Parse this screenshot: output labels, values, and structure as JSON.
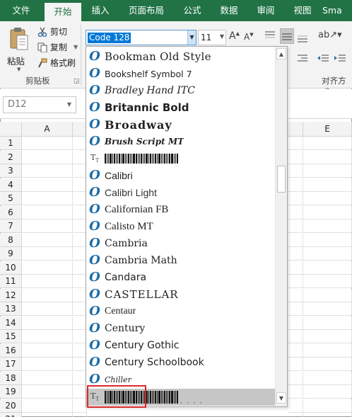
{
  "tabs": [
    "文件",
    "开始",
    "插入",
    "页面布局",
    "公式",
    "数据",
    "审阅",
    "视图",
    "Sma"
  ],
  "active_tab": "开始",
  "clipboard": {
    "paste_label": "粘贴",
    "cut_label": "剪切",
    "copy_label": "复制",
    "format_painter_label": "格式刷",
    "group_label": "剪贴板"
  },
  "font": {
    "name_value": "Code 128",
    "size_value": "11"
  },
  "alignment": {
    "group_label": "对齐方式"
  },
  "name_box": {
    "value": "D12"
  },
  "columns": [
    "A",
    "E"
  ],
  "rows": [
    "1",
    "2",
    "3",
    "4",
    "5",
    "6",
    "7",
    "8",
    "9",
    "10",
    "11",
    "12",
    "13",
    "14",
    "15",
    "16",
    "17",
    "18",
    "19",
    "20",
    "21"
  ],
  "font_list": [
    {
      "name": "Bookman Old Style",
      "kind": "opentype"
    },
    {
      "name": "Bookshelf Symbol 7",
      "kind": "opentype"
    },
    {
      "name": "Bradley Hand ITC",
      "kind": "opentype"
    },
    {
      "name": "Britannic Bold",
      "kind": "opentype"
    },
    {
      "name": "Broadway",
      "kind": "opentype"
    },
    {
      "name": "Brush Script MT",
      "kind": "opentype"
    },
    {
      "name": "",
      "kind": "truetype-barcode"
    },
    {
      "name": "Calibri",
      "kind": "opentype"
    },
    {
      "name": "Calibri Light",
      "kind": "opentype"
    },
    {
      "name": "Californian FB",
      "kind": "opentype"
    },
    {
      "name": "Calisto MT",
      "kind": "opentype"
    },
    {
      "name": "Cambria",
      "kind": "opentype"
    },
    {
      "name": "Cambria Math",
      "kind": "opentype"
    },
    {
      "name": "Candara",
      "kind": "opentype"
    },
    {
      "name": "CASTELLAR",
      "kind": "opentype"
    },
    {
      "name": "Centaur",
      "kind": "opentype"
    },
    {
      "name": "Century",
      "kind": "opentype"
    },
    {
      "name": "Century Gothic",
      "kind": "opentype"
    },
    {
      "name": "Century Schoolbook",
      "kind": "opentype"
    },
    {
      "name": "Chiller",
      "kind": "opentype"
    },
    {
      "name": "",
      "kind": "truetype-barcode",
      "highlighted": true
    }
  ],
  "colors": {
    "ribbon_green": "#217346",
    "highlight_red": "#d62a2a",
    "selection_blue": "#0078d7"
  }
}
